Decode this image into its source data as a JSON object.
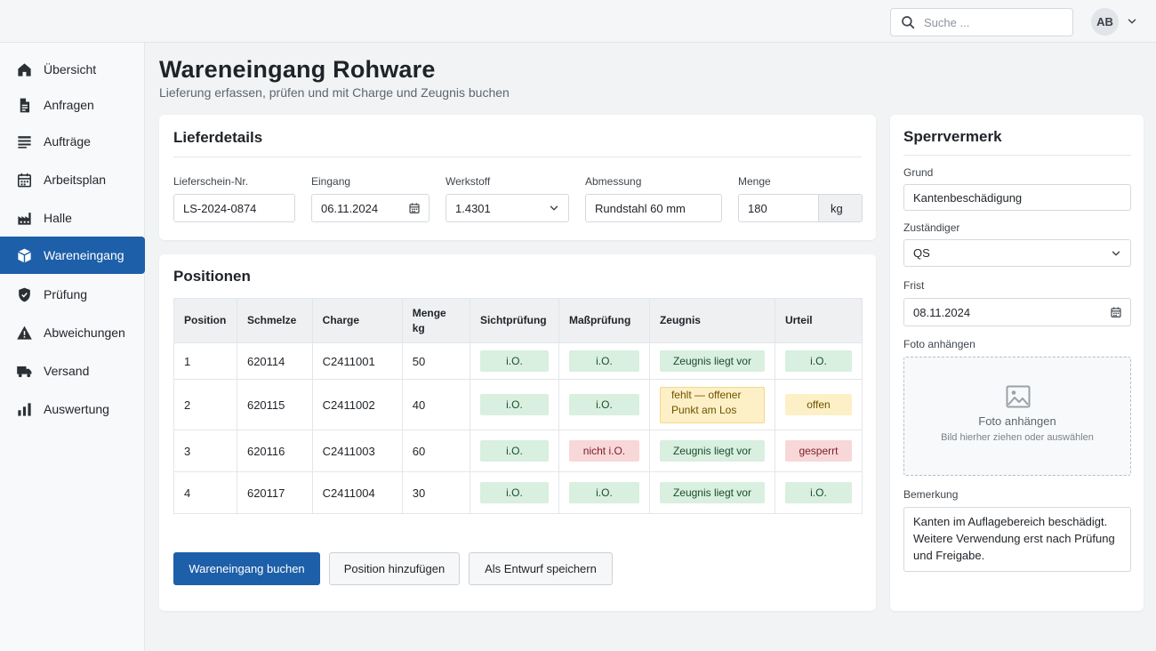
{
  "header": {
    "search": {
      "placeholder": "Suche ...",
      "icon": "search-icon"
    },
    "user": {
      "initials": "AB",
      "menu_icon": "chevron-down-icon"
    }
  },
  "sidebar": {
    "active_index": 5,
    "items": [
      {
        "label": "Übersicht",
        "icon": "home-icon"
      },
      {
        "label": "Anfragen",
        "icon": "document-icon"
      },
      {
        "label": "Aufträge",
        "icon": "list-icon"
      },
      {
        "label": "Arbeitsplan",
        "icon": "calendar-icon"
      },
      {
        "label": "Halle",
        "icon": "factory-icon"
      },
      {
        "label": "Wareneingang",
        "icon": "package-icon"
      },
      {
        "label": "Prüfung",
        "icon": "shield-icon"
      },
      {
        "label": "Abweichungen",
        "icon": "warning-icon"
      },
      {
        "label": "Versand",
        "icon": "truck-icon"
      },
      {
        "label": "Auswertung",
        "icon": "bar-chart-icon"
      }
    ]
  },
  "page": {
    "title": "Wareneingang Rohware",
    "subtitle": "Lieferung erfassen, prüfen und mit Charge und Zeugnis buchen"
  },
  "lieferdetails": {
    "title": "Lieferdetails",
    "lieferschein": {
      "label": "Lieferschein-Nr.",
      "value": "LS-2024-0874"
    },
    "eingang": {
      "label": "Eingang",
      "value": "06.11.2024",
      "icon": "calendar-icon"
    },
    "werkstoff": {
      "label": "Werkstoff",
      "value": "1.4301",
      "icon": "chevron-down-icon"
    },
    "abmessung": {
      "label": "Abmessung",
      "value": "Rundstahl 60 mm"
    },
    "menge": {
      "label": "Menge",
      "value": "180",
      "unit": "kg"
    }
  },
  "positionen": {
    "title": "Positionen",
    "columns": {
      "position": "Position",
      "schmelze": "Schmelze",
      "charge": "Charge",
      "menge_line1": "Menge",
      "menge_line2": "kg",
      "sicht": "Sichtprüfung",
      "mass": "Maßprüfung",
      "zeugnis": "Zeugnis",
      "urteil": "Urteil"
    },
    "rows": [
      {
        "position": "1",
        "schmelze": "620114",
        "charge": "C2411001",
        "menge": "50",
        "sicht": "i.O.",
        "mass": "i.O.",
        "zeugnis_line1": "Zeugnis liegt vor",
        "zeugnis_line2": "",
        "urteil": "i.O."
      },
      {
        "position": "2",
        "schmelze": "620115",
        "charge": "C2411002",
        "menge": "40",
        "sicht": "i.O.",
        "mass": "i.O.",
        "zeugnis_line1": "fehlt — offener",
        "zeugnis_line2": "Punkt am Los",
        "urteil": "offen"
      },
      {
        "position": "3",
        "schmelze": "620116",
        "charge": "C2411003",
        "menge": "60",
        "sicht": "i.O.",
        "mass": "nicht i.O.",
        "zeugnis_line1": "Zeugnis liegt vor",
        "zeugnis_line2": "",
        "urteil": "gesperrt"
      },
      {
        "position": "4",
        "schmelze": "620117",
        "charge": "C2411004",
        "menge": "30",
        "sicht": "i.O.",
        "mass": "i.O.",
        "zeugnis_line1": "Zeugnis liegt vor",
        "zeugnis_line2": "",
        "urteil": "i.O."
      }
    ],
    "status_colors": {
      "ok": "#d9efe0",
      "bad": "#f8d7d9",
      "warn": "#fdf0c6"
    }
  },
  "actions": {
    "book": "Wareneingang buchen",
    "add": "Position hinzufügen",
    "draft": "Als Entwurf speichern"
  },
  "sperrvermerk": {
    "title": "Sperrvermerk",
    "grund": {
      "label": "Grund",
      "value": "Kantenbeschädigung"
    },
    "zustaendiger": {
      "label": "Zuständiger",
      "value": "QS",
      "icon": "chevron-down-icon"
    },
    "frist": {
      "label": "Frist",
      "value": "08.11.2024",
      "icon": "calendar-icon"
    },
    "foto": {
      "label": "Foto anhängen",
      "upload_title": "Foto anhängen",
      "upload_hint": "Bild hierher ziehen oder auswählen",
      "icon": "image-icon"
    },
    "bemerkung": {
      "label": "Bemerkung",
      "value": "Kanten im Auflagebereich beschädigt. Weitere Verwendung erst nach Prüfung und Freigabe."
    }
  },
  "colors": {
    "accent": "#1d5fa8",
    "background": "#f1f3f5"
  }
}
